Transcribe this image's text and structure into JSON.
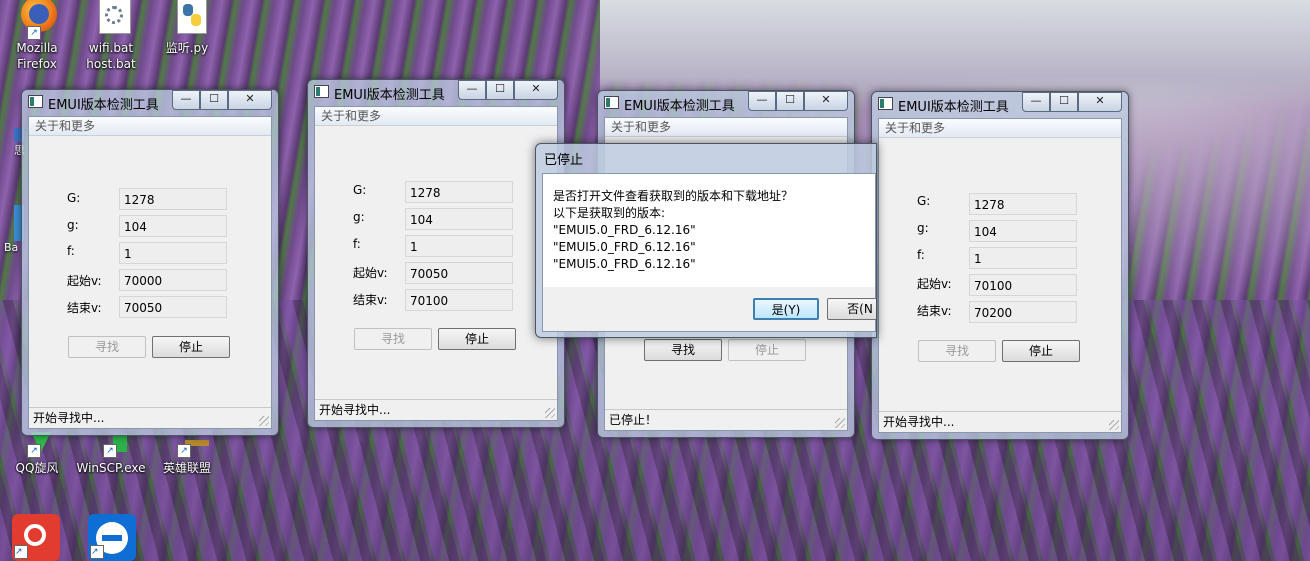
{
  "desktop": {
    "icons": [
      {
        "label": "Mozilla\nFirefox",
        "icon": "firefox-icon"
      },
      {
        "label": "wifi.bat\nhost.bat",
        "icon": "batch-file-icon"
      },
      {
        "label": "监听.py",
        "icon": "python-file-icon"
      },
      {
        "label": "QQ旋风",
        "icon": "qq-whirlwind-icon"
      },
      {
        "label": "WinSCP.exe",
        "icon": "winscp-icon"
      },
      {
        "label": "英雄联盟",
        "icon": "league-of-legends-icon"
      },
      {
        "label": "",
        "icon": "netease-music-icon"
      },
      {
        "label": "",
        "icon": "teamviewer-icon"
      }
    ],
    "partial_labels": [
      "思",
      "Ba"
    ]
  },
  "windows": [
    {
      "title": "EMUI版本检测工具",
      "menu": "关于和更多",
      "labels": {
        "G": "G:",
        "g": "g:",
        "f": "f:",
        "start": "起始v:",
        "end": "结束v:"
      },
      "values": {
        "G": "1278",
        "g": "104",
        "f": "1",
        "start": "70000",
        "end": "70050"
      },
      "buttons": {
        "find": "寻找",
        "stop": "停止"
      },
      "status": "开始寻找中..."
    },
    {
      "title": "EMUI版本检测工具",
      "menu": "关于和更多",
      "labels": {
        "G": "G:",
        "g": "g:",
        "f": "f:",
        "start": "起始v:",
        "end": "结束v:"
      },
      "values": {
        "G": "1278",
        "g": "104",
        "f": "1",
        "start": "70050",
        "end": "70100"
      },
      "buttons": {
        "find": "寻找",
        "stop": "停止"
      },
      "status": "开始寻找中..."
    },
    {
      "title": "EMUI版本检测工具",
      "menu": "关于和更多",
      "buttons": {
        "find": "寻找",
        "stop": "停止"
      },
      "status": "已停止！"
    },
    {
      "title": "EMUI版本检测工具",
      "menu": "关于和更多",
      "labels": {
        "G": "G:",
        "g": "g:",
        "f": "f:",
        "start": "起始v:",
        "end": "结束v:"
      },
      "values": {
        "G": "1278",
        "g": "104",
        "f": "1",
        "start": "70100",
        "end": "70200"
      },
      "buttons": {
        "find": "寻找",
        "stop": "停止"
      },
      "status": "开始寻找中..."
    }
  ],
  "dialog": {
    "title": "已停止",
    "lines": [
      "是否打开文件查看获取到的版本和下载地址？",
      "以下是获取到的版本:",
      "\"EMUI5.0_FRD_6.12.16\"",
      "\"EMUI5.0_FRD_6.12.16\"",
      "\"EMUI5.0_FRD_6.12.16\""
    ],
    "yes": "是(Y)",
    "no": "否(N"
  },
  "window_controls": {
    "minimize": "—",
    "maximize": "☐",
    "close": "✕"
  }
}
